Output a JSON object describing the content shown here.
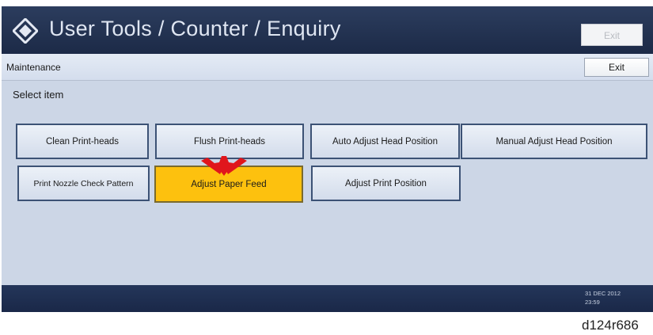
{
  "header": {
    "title": "User Tools / Counter / Enquiry",
    "exit_label": "Exit",
    "logo_icon": "diamond-logo-icon"
  },
  "subheader": {
    "label": "Maintenance",
    "exit_label": "Exit"
  },
  "prompt": "Select item",
  "buttons": [
    {
      "label": "Clean Print-heads"
    },
    {
      "label": "Flush Print-heads"
    },
    {
      "label": "Auto Adjust Head Position"
    },
    {
      "label": "Manual Adjust Head Position"
    },
    {
      "label": "Print Nozzle Check Pattern"
    },
    {
      "label": "Adjust Paper Feed",
      "selected": true
    },
    {
      "label": "Adjust Print Position"
    }
  ],
  "status": {
    "date": "31 DEC 2012",
    "time": "23:59"
  },
  "figure_label": "d124r686",
  "colors": {
    "title_bar": "#1c2a47",
    "panel": "#ccd6e6",
    "selected": "#fdc10e",
    "arrow": "#e0161c"
  }
}
